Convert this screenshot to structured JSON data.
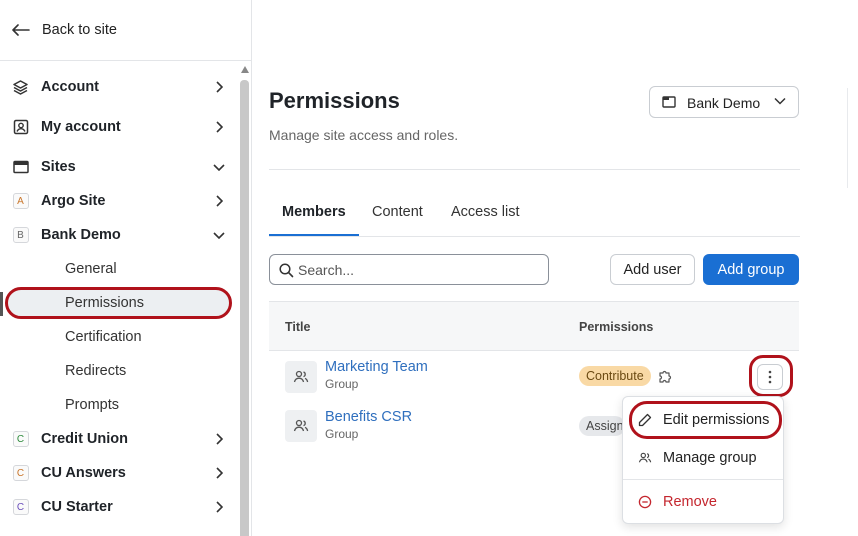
{
  "sidebar": {
    "back_label": "Back to site",
    "items": [
      {
        "label": "Account",
        "icon": "layers-icon",
        "expanded": false
      },
      {
        "label": "My account",
        "icon": "user-card-icon",
        "expanded": false
      },
      {
        "label": "Sites",
        "icon": "browser-window-icon",
        "expanded": true
      },
      {
        "label": "Argo Site",
        "badge": "A",
        "badge_color": "#c9762b",
        "expanded": false
      },
      {
        "label": "Bank Demo",
        "badge": "B",
        "badge_color": "#666666",
        "expanded": true
      },
      {
        "label": "General"
      },
      {
        "label": "Permissions",
        "active": true
      },
      {
        "label": "Certification"
      },
      {
        "label": "Redirects"
      },
      {
        "label": "Prompts"
      },
      {
        "label": "Credit Union",
        "badge": "C",
        "badge_color": "#2e8b3d",
        "expanded": false
      },
      {
        "label": "CU Answers",
        "badge": "C",
        "badge_color": "#c9762b",
        "expanded": false
      },
      {
        "label": "CU Starter",
        "badge": "C",
        "badge_color": "#6b4fbb",
        "expanded": false
      }
    ]
  },
  "header": {
    "title": "Permissions",
    "subtitle": "Manage site access and roles.",
    "site_selector": "Bank Demo"
  },
  "tabs": [
    {
      "label": "Members",
      "active": true
    },
    {
      "label": "Content"
    },
    {
      "label": "Access list"
    }
  ],
  "toolbar": {
    "search_placeholder": "Search...",
    "add_user": "Add user",
    "add_group": "Add group"
  },
  "table": {
    "columns": [
      "Title",
      "Permissions"
    ],
    "rows": [
      {
        "name": "Marketing Team",
        "type": "Group",
        "permission": "Contribute",
        "permission_color": "#f9d9a5"
      },
      {
        "name": "Benefits CSR",
        "type": "Group",
        "permission": "Assign",
        "permission_color": "#e6e8eb"
      }
    ]
  },
  "menu": {
    "items": [
      {
        "label": "Edit permissions",
        "icon": "pencil-icon"
      },
      {
        "label": "Manage group",
        "icon": "users-icon"
      },
      {
        "label": "Remove",
        "icon": "minus-circle-icon",
        "color": "#c4262e"
      }
    ]
  },
  "colors": {
    "accent": "#1a6fd3",
    "highlight_ring": "#b0121b",
    "link": "#2f6fbe"
  }
}
